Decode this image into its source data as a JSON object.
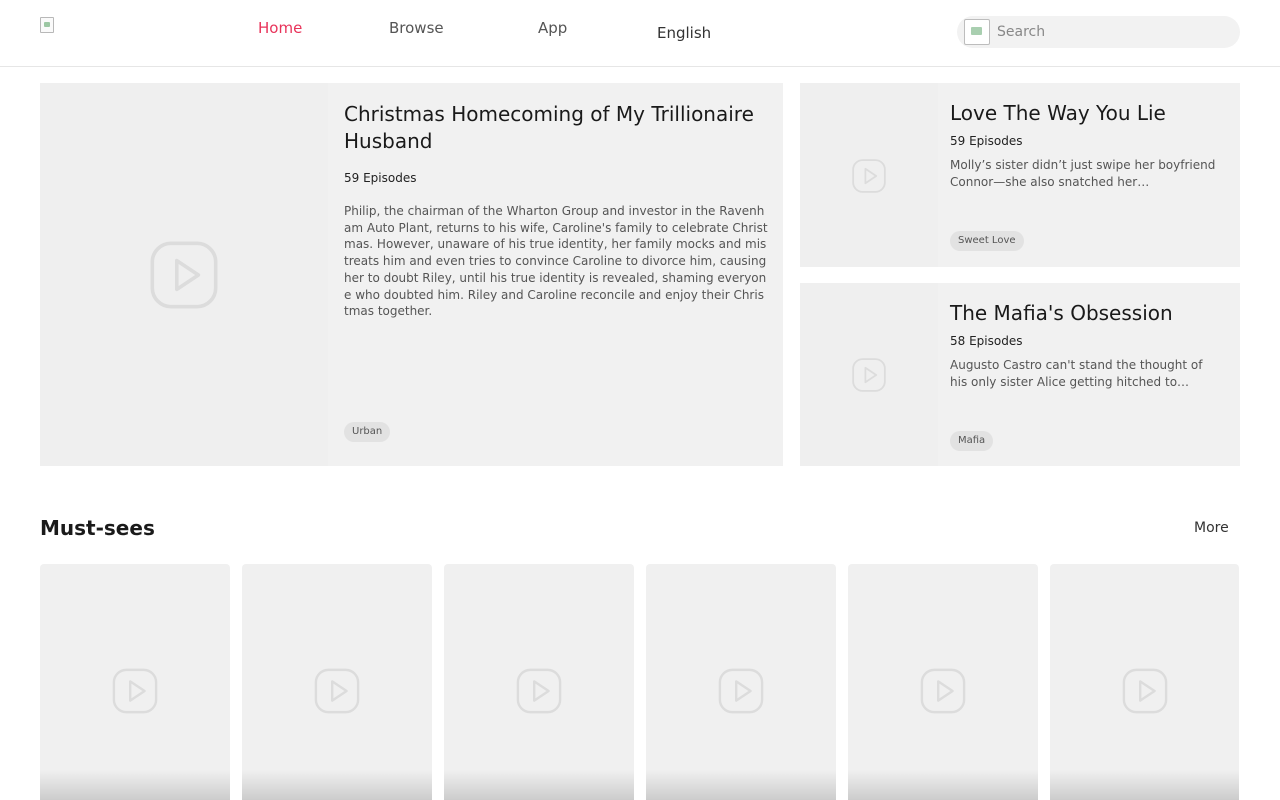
{
  "header": {
    "nav": [
      {
        "label": "Home",
        "active": true
      },
      {
        "label": "Browse",
        "active": false
      },
      {
        "label": "App",
        "active": false
      }
    ],
    "language": "English",
    "search": {
      "placeholder": "Search"
    },
    "accent_color": "#e8335a"
  },
  "featured": {
    "main": {
      "title": "Christmas Homecoming of My Trillionaire Husband",
      "episodes": "59 Episodes",
      "description": "Philip, the chairman of the Wharton Group and investor in the Ravenham Auto Plant, returns to his wife, Caroline's family to celebrate Christmas. However, unaware of his true identity, her family mocks and mistreats him and even tries to convince Caroline to divorce him, causing her to doubt Riley, until his true identity is revealed, shaming everyone who doubted him. Riley and Caroline reconcile and enjoy their Christmas together.",
      "tag": "Urban"
    },
    "side": [
      {
        "title": "Love The Way You Lie",
        "episodes": "59 Episodes",
        "description": "Molly’s sister didn’t just swipe her boyfriend Connor—she also snatched her inheritance,...",
        "tag": "Sweet Love"
      },
      {
        "title": "The Mafia's Obsession",
        "episodes": "58 Episodes",
        "description": "Augusto Castro can't stand the thought of his only sister Alice getting hitched to some...",
        "tag": "Mafia"
      }
    ]
  },
  "must_sees": {
    "title": "Must-sees",
    "more_label": "More",
    "tile_count": 6
  }
}
